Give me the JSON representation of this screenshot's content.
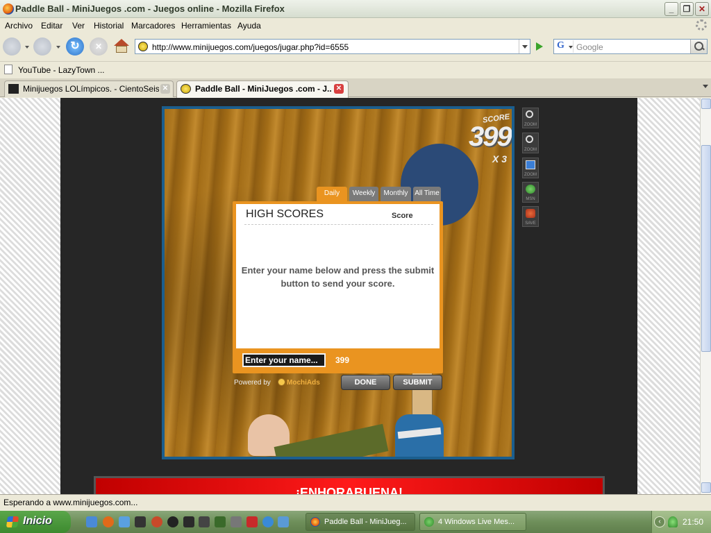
{
  "window": {
    "title": "Paddle Ball - MiniJuegos .com - Juegos online - Mozilla Firefox",
    "min_label": "_",
    "max_label": "❐",
    "close_label": "✕"
  },
  "menu": {
    "items": [
      "Archivo",
      "Editar",
      "Ver",
      "Historial",
      "Marcadores",
      "Herramientas",
      "Ayuda"
    ]
  },
  "nav": {
    "url": "http://www.minijuegos.com/juegos/jugar.php?id=6555",
    "search_engine": "G",
    "search_placeholder": "Google",
    "reload_glyph": "↻",
    "stop_glyph": "✕"
  },
  "bookmarks": {
    "items": [
      "YouTube - LazyTown ..."
    ]
  },
  "tabs": [
    {
      "label": "Minijuegos LOLímpicos. - CientoSeis",
      "active": false
    },
    {
      "label": "Paddle Ball - MiniJuegos .com - J...",
      "active": true
    }
  ],
  "game": {
    "score_word": "SCORE",
    "score": "399",
    "multiplier": "X 3",
    "side_tools": [
      "ZOOM",
      "ZOOM",
      "ZOOM",
      "MSN",
      "SAVE"
    ]
  },
  "high_scores": {
    "tabs": [
      "Daily",
      "Weekly",
      "Monthly",
      "All Time"
    ],
    "active_tab": "Daily",
    "title": "HIGH SCORES",
    "column": "Score",
    "message": "Enter your name below and press the submit button to send your score.",
    "name_input_value": "Enter your name...",
    "score": "399",
    "powered_by": "Powered by",
    "provider": "MochiAds",
    "done_label": "DONE",
    "submit_label": "SUBMIT"
  },
  "banner": {
    "text": "¡ENHORABUENA!"
  },
  "status": {
    "text": "Esperando a www.minijuegos.com..."
  },
  "taskbar": {
    "start_label": "Inicio",
    "tasks": [
      {
        "label": "Paddle Ball - MiniJueg...",
        "active": true
      },
      {
        "label": "4 Windows Live Mes...",
        "active": false
      }
    ],
    "clock": "21:50",
    "chevron_glyph": "‹"
  },
  "colors": {
    "panel_orange": "#ea9420",
    "game_frame": "#1b5e8e",
    "banner_red": "#e00000",
    "taskbar_green": "#6e8f5a"
  }
}
